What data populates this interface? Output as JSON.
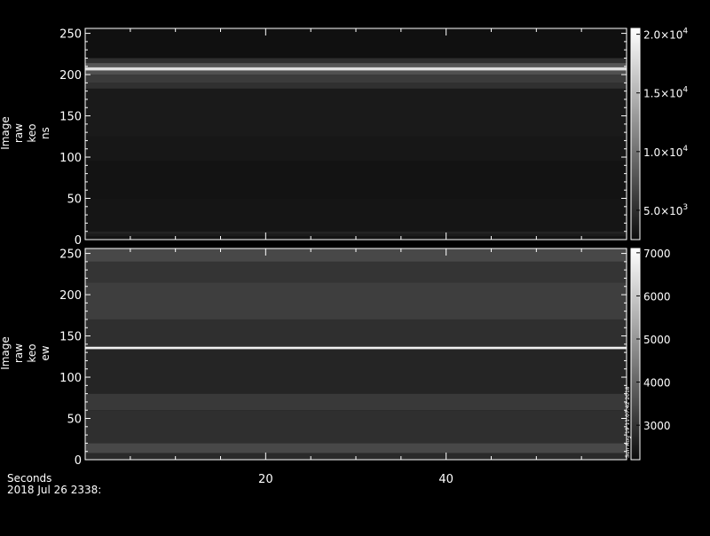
{
  "chart_data": [
    {
      "type": "heatmap",
      "ylabel": [
        "Image",
        "raw",
        "keo",
        "ns"
      ],
      "ylim": [
        0,
        256
      ],
      "yticks": [
        0,
        50,
        100,
        150,
        200,
        250
      ],
      "xlim": [
        0,
        60
      ],
      "xticks": [
        20,
        40
      ],
      "colorbar": {
        "range": [
          2500,
          20500
        ],
        "ticks": [
          {
            "value": 5000,
            "mant": "5.0×10",
            "exp": "3"
          },
          {
            "value": 10000,
            "mant": "1.0×10",
            "exp": "4"
          },
          {
            "value": 15000,
            "mant": "1.5×10",
            "exp": "4"
          },
          {
            "value": 20000,
            "mant": "2.0×10",
            "exp": "4"
          }
        ]
      },
      "rows": [
        {
          "y0": 0,
          "y1": 4,
          "value": 3000
        },
        {
          "y0": 4,
          "y1": 7,
          "value": 3600
        },
        {
          "y0": 7,
          "y1": 10,
          "value": 4200
        },
        {
          "y0": 10,
          "y1": 50,
          "value": 3200
        },
        {
          "y0": 50,
          "y1": 95,
          "value": 3000
        },
        {
          "y0": 95,
          "y1": 125,
          "value": 3300
        },
        {
          "y0": 125,
          "y1": 183,
          "value": 3500
        },
        {
          "y0": 183,
          "y1": 190,
          "value": 5200
        },
        {
          "y0": 190,
          "y1": 200,
          "value": 6000
        },
        {
          "y0": 200,
          "y1": 205,
          "value": 7500
        },
        {
          "y0": 205,
          "y1": 209,
          "value": 18000
        },
        {
          "y0": 209,
          "y1": 214,
          "value": 8000
        },
        {
          "y0": 214,
          "y1": 220,
          "value": 5000
        },
        {
          "y0": 220,
          "y1": 256,
          "value": 2800
        }
      ]
    },
    {
      "type": "heatmap",
      "ylabel": [
        "Image",
        "raw",
        "keo",
        "ew"
      ],
      "ylim": [
        0,
        256
      ],
      "yticks": [
        0,
        50,
        100,
        150,
        200,
        250
      ],
      "xlim": [
        0,
        60
      ],
      "xticks": [
        20,
        40
      ],
      "colorbar": {
        "range": [
          2200,
          7100
        ],
        "ticks": [
          {
            "value": 3000,
            "label": "3000"
          },
          {
            "value": 4000,
            "label": "4000"
          },
          {
            "value": 5000,
            "label": "5000"
          },
          {
            "value": 6000,
            "label": "6000"
          },
          {
            "value": 7000,
            "label": "7000"
          }
        ]
      },
      "rows": [
        {
          "y0": 0,
          "y1": 8,
          "value": 2800
        },
        {
          "y0": 8,
          "y1": 20,
          "value": 3400
        },
        {
          "y0": 20,
          "y1": 60,
          "value": 2900
        },
        {
          "y0": 60,
          "y1": 80,
          "value": 3100
        },
        {
          "y0": 80,
          "y1": 134,
          "value": 2700
        },
        {
          "y0": 134,
          "y1": 137,
          "value": 6800
        },
        {
          "y0": 137,
          "y1": 170,
          "value": 2900
        },
        {
          "y0": 170,
          "y1": 215,
          "value": 3200
        },
        {
          "y0": 215,
          "y1": 240,
          "value": 3000
        },
        {
          "y0": 240,
          "y1": 256,
          "value": 3400
        }
      ],
      "side_note": "Sun Aug 19 11:07:42 2018"
    }
  ],
  "footer": {
    "xlabel": "Seconds",
    "datetime": "2018 Jul 26 2338:"
  }
}
